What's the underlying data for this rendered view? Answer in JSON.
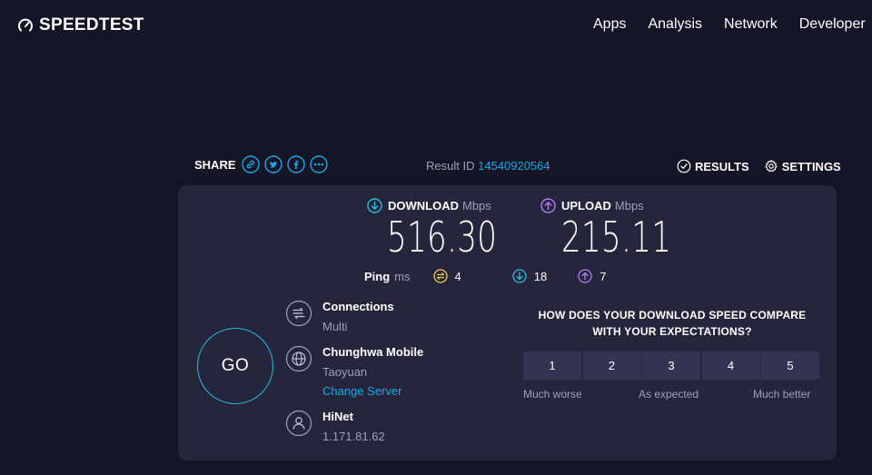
{
  "header": {
    "logo": "SPEEDTEST",
    "nav": [
      "Apps",
      "Analysis",
      "Network",
      "Developer"
    ]
  },
  "share": {
    "label": "SHARE",
    "icons": [
      "link-icon",
      "twitter-icon",
      "facebook-icon",
      "more-icon"
    ]
  },
  "result": {
    "label": "Result ID",
    "id": "14540920564"
  },
  "links": {
    "results": "RESULTS",
    "settings": "SETTINGS"
  },
  "download": {
    "label": "DOWNLOAD",
    "unit": "Mbps",
    "value": "516.30"
  },
  "upload": {
    "label": "UPLOAD",
    "unit": "Mbps",
    "value": "215.11"
  },
  "ping": {
    "label": "Ping",
    "unit": "ms",
    "idle": "4",
    "download": "18",
    "upload": "7"
  },
  "go": "GO",
  "connections": {
    "title": "Connections",
    "value": "Multi"
  },
  "server": {
    "name": "Chunghwa Mobile",
    "location": "Taoyuan",
    "change": "Change Server"
  },
  "isp": {
    "name": "HiNet",
    "ip": "1.171.81.62"
  },
  "survey": {
    "question_line1": "HOW DOES YOUR DOWNLOAD SPEED COMPARE",
    "question_line2": "WITH YOUR EXPECTATIONS?",
    "options": [
      "1",
      "2",
      "3",
      "4",
      "5"
    ],
    "low": "Much worse",
    "mid": "As expected",
    "high": "Much better"
  },
  "colors": {
    "background": "#141526",
    "card": "#25253c",
    "accent": "#1aa8e8",
    "download": "#27bde1",
    "upload": "#b57cf5",
    "idle": "#f7c95a"
  }
}
